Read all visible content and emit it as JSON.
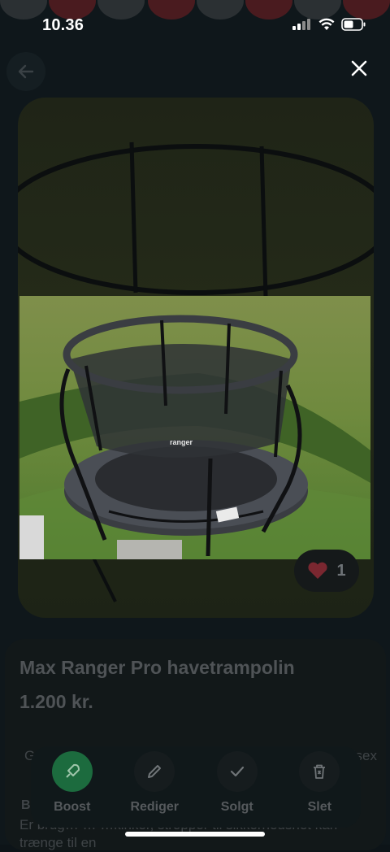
{
  "status": {
    "time": "10.36"
  },
  "listing": {
    "title": "Max Ranger Pro havetrampolin",
    "price": "1.200 kr.",
    "meta_left": "G",
    "meta_right": "isex",
    "desc_head": "B",
    "description": "Er brug… … …kinker, stropper til sikkerhedsnet kan trænge til en"
  },
  "likes": {
    "count": "1"
  },
  "actions": [
    {
      "label": "Boost",
      "icon": "rocket-icon",
      "accent": "#1a7a45"
    },
    {
      "label": "Rediger",
      "icon": "pencil-icon"
    },
    {
      "label": "Solgt",
      "icon": "check-icon"
    },
    {
      "label": "Slet",
      "icon": "trash-icon"
    }
  ],
  "photo": {
    "brand_text": "ranger"
  },
  "colors": {
    "accent_green": "#1f8a4c",
    "heart": "#8a2a33"
  }
}
